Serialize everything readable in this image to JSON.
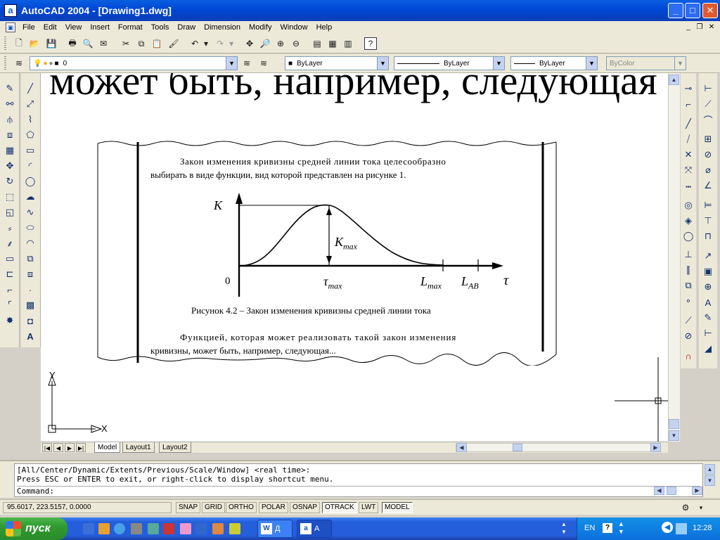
{
  "window": {
    "title": "AutoCAD 2004 - [Drawing1.dwg]",
    "app_icon": "a"
  },
  "menu": [
    "File",
    "Edit",
    "View",
    "Insert",
    "Format",
    "Tools",
    "Draw",
    "Dimension",
    "Modify",
    "Window",
    "Help"
  ],
  "properties": {
    "layer": "0",
    "color": "ByLayer",
    "linetype": "ByLayer",
    "lineweight": "ByLayer",
    "plotstyle": "ByColor"
  },
  "drawing": {
    "large_text": "может быть, например, следующая",
    "para1_line1": "Закон изменения кривизны средней линии тока целесообразно",
    "para1_line2": "выбирать в виде функции, вид которой представлен на рисунке 1.",
    "graph": {
      "k_label": "K",
      "zero_label": "0",
      "kmax_main": "K",
      "kmax_sub": "max",
      "tau_main": "τ",
      "tau_sub": "max",
      "lmax_main": "L",
      "lmax_sub": "max",
      "lab_main": "L",
      "lab_sub": "AB",
      "tau_axis": "τ"
    },
    "caption": "Рисунок 4.2 – Закон изменения кривизны средней линии тока",
    "para2_line1": "Функцией, которая может реализовать такой закон изменения",
    "para2_line2": "кривизны, может быть, например, следующая...",
    "ucs_x": "X",
    "ucs_y": "Y"
  },
  "tabs": [
    "Model",
    "Layout1",
    "Layout2"
  ],
  "command": {
    "line1": "[All/Center/Dynamic/Extents/Previous/Scale/Window] <real time>:",
    "line2": "Press ESC or ENTER to exit, or right-click to display shortcut menu.",
    "prompt": "Command:"
  },
  "status": {
    "coords": "95.6017, 223.5157, 0.0000",
    "buttons": [
      "SNAP",
      "GRID",
      "ORTHO",
      "POLAR",
      "OSNAP",
      "OTRACK",
      "LWT",
      "MODEL"
    ]
  },
  "taskbar": {
    "start": "пуск",
    "tasks": [
      "Д",
      "A"
    ],
    "lang": "EN",
    "clock": "12:28"
  }
}
